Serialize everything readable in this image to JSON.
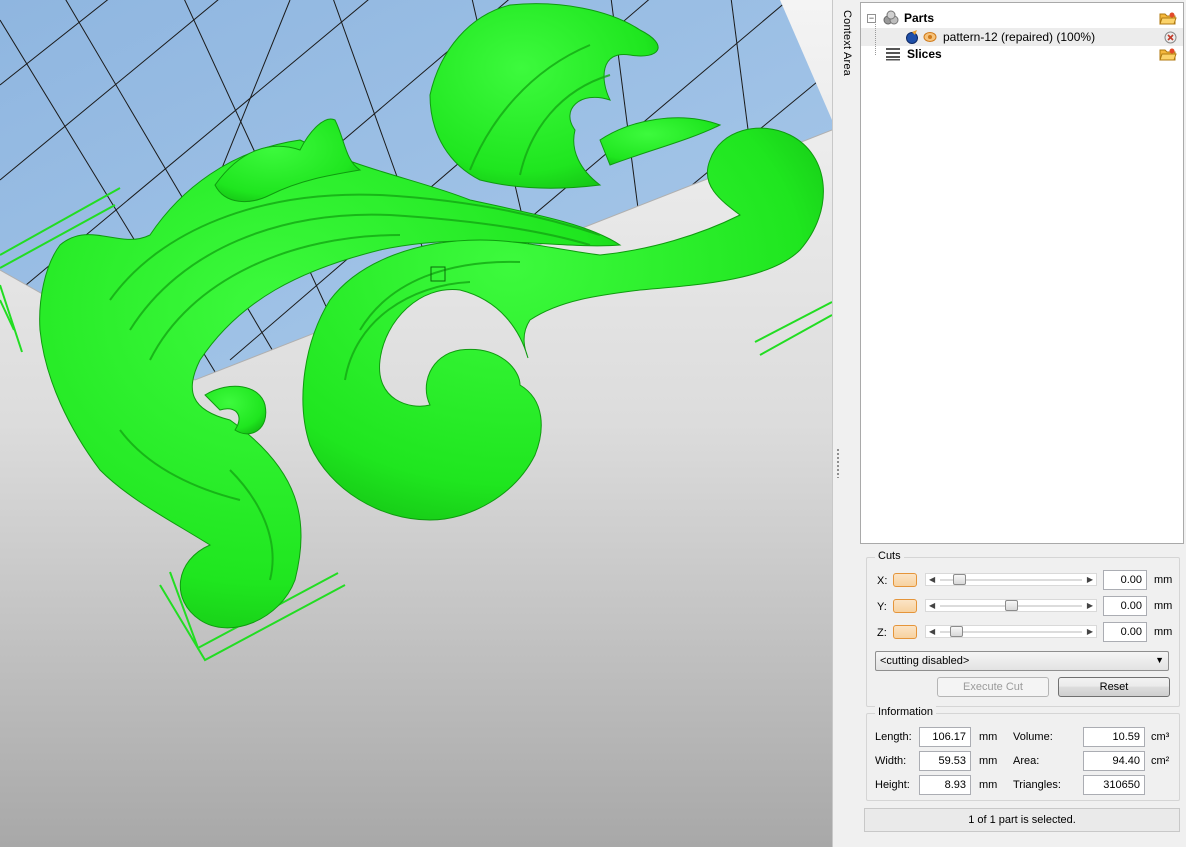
{
  "context_area_label": "Context Area",
  "tree": {
    "parts_label": "Parts",
    "part_name": "pattern-12 (repaired) (100%)",
    "slices_label": "Slices",
    "expander_symbol": "−"
  },
  "cuts": {
    "title": "Cuts",
    "axes": [
      {
        "label": "X:",
        "value": "0.00",
        "unit": "mm",
        "slider_fraction": 0.1
      },
      {
        "label": "Y:",
        "value": "0.00",
        "unit": "mm",
        "slider_fraction": 0.5
      },
      {
        "label": "Z:",
        "value": "0.00",
        "unit": "mm",
        "slider_fraction": 0.08
      }
    ],
    "mode_selected": "<cutting disabled>",
    "execute_label": "Execute Cut",
    "reset_label": "Reset"
  },
  "information": {
    "title": "Information",
    "length_label": "Length:",
    "length_value": "106.17",
    "length_unit": "mm",
    "width_label": "Width:",
    "width_value": "59.53",
    "width_unit": "mm",
    "height_label": "Height:",
    "height_value": "8.93",
    "height_unit": "mm",
    "volume_label": "Volume:",
    "volume_value": "10.59",
    "volume_unit": "cm³",
    "area_label": "Area:",
    "area_value": "94.40",
    "area_unit": "cm²",
    "triangles_label": "Triangles:",
    "triangles_value": "310650"
  },
  "status_text": "1 of 1 part is selected.",
  "colors": {
    "model_green": "#22ee22",
    "platform_blue": "#9fc3e6",
    "accent_orange": "#e5953a"
  }
}
